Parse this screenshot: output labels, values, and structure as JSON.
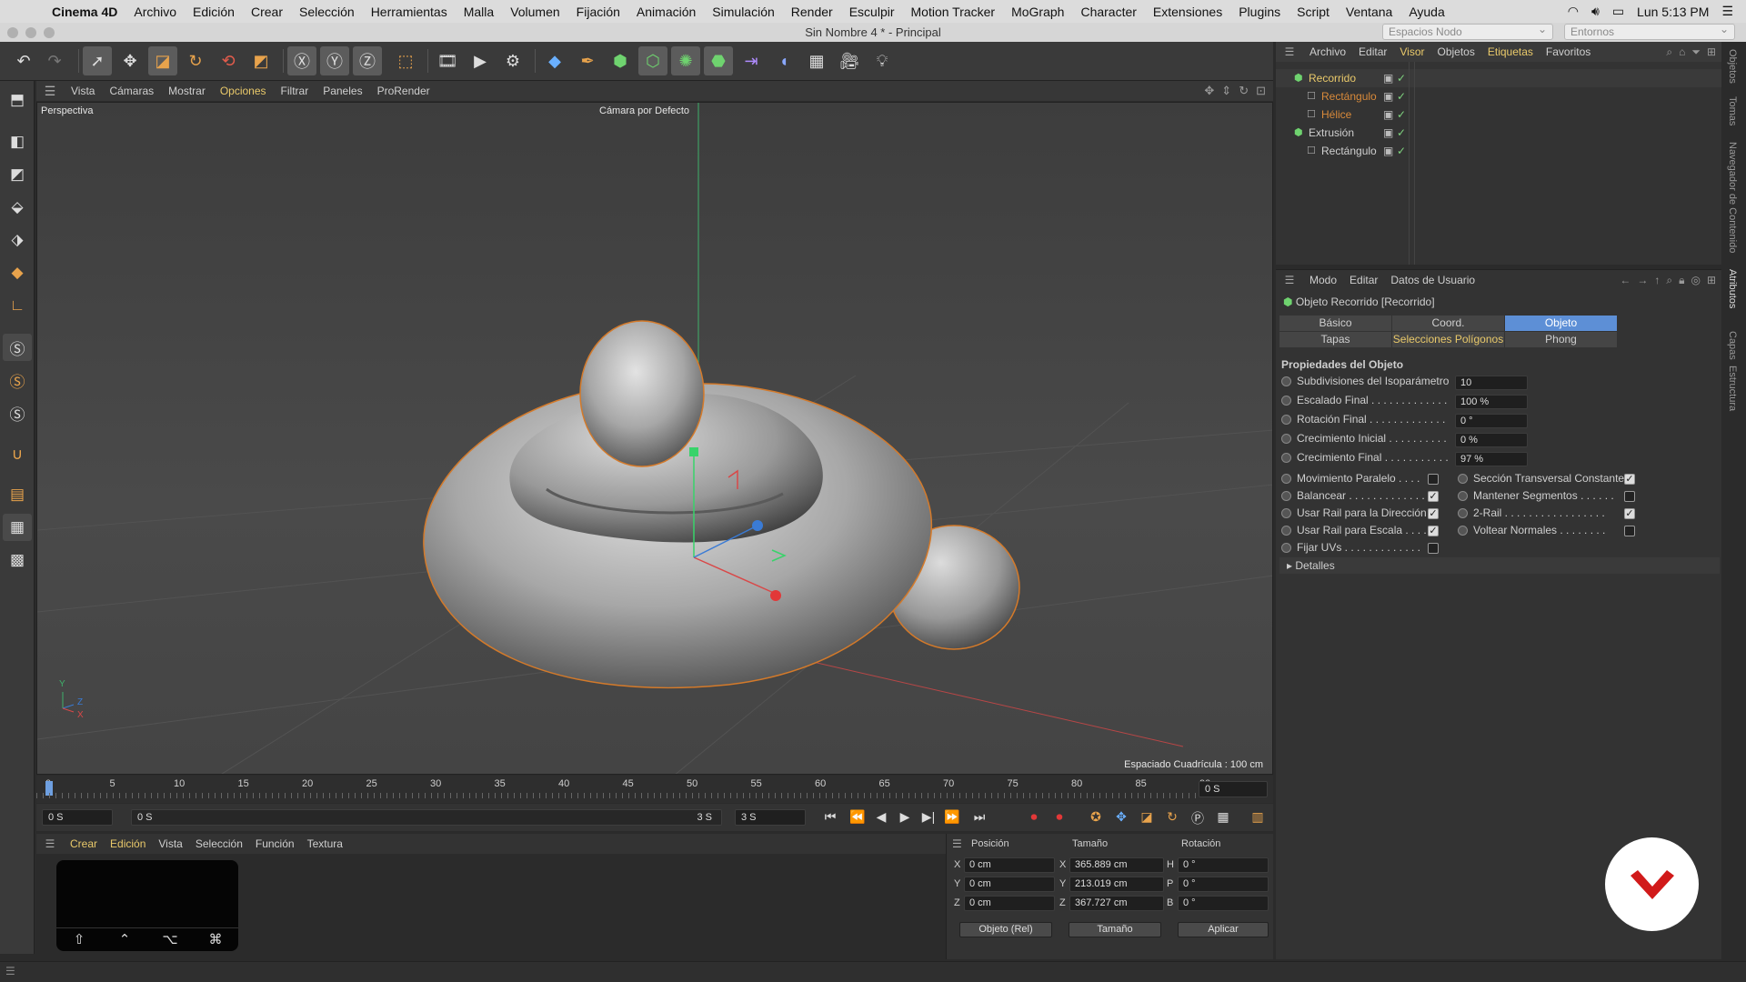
{
  "macmenu": {
    "app": "Cinema 4D",
    "items": [
      "Archivo",
      "Edición",
      "Crear",
      "Selección",
      "Herramientas",
      "Malla",
      "Volumen",
      "Fijación",
      "Animación",
      "Simulación",
      "Render",
      "Esculpir",
      "Motion Tracker",
      "MoGraph",
      "Character",
      "Extensiones",
      "Plugins",
      "Script",
      "Ventana",
      "Ayuda"
    ],
    "clock": "Lun 5:13 PM"
  },
  "window": {
    "title": "Sin Nombre 4 * - Principal",
    "node_spaces": "Espacios Nodo",
    "environments": "Entornos"
  },
  "viewport": {
    "menu": [
      "Vista",
      "Cámaras",
      "Mostrar",
      "Opciones",
      "Filtrar",
      "Paneles",
      "ProRender"
    ],
    "highlighted_menu": "Opciones",
    "view_name": "Perspectiva",
    "camera": "Cámara por Defecto",
    "grid_spacing": "Espaciado Cuadrícula : 100 cm",
    "axis_labels": {
      "y": "Y",
      "z": "Z",
      "x": "X"
    }
  },
  "timeline": {
    "ticks": [
      "0",
      "5",
      "10",
      "15",
      "20",
      "25",
      "30",
      "35",
      "40",
      "45",
      "50",
      "55",
      "60",
      "65",
      "70",
      "75",
      "80",
      "85",
      "90"
    ],
    "current_frame": "0 S",
    "start": "0 S",
    "range_start": "0 S",
    "range_end": "3 S",
    "end": "3 S"
  },
  "material_manager": {
    "menu": [
      "Crear",
      "Edición",
      "Vista",
      "Selección",
      "Función",
      "Textura"
    ],
    "highlighted": [
      "Crear",
      "Edición"
    ],
    "keys": [
      "⇧",
      "⌃",
      "⌥",
      "⌘"
    ]
  },
  "coordinates": {
    "headers": [
      "Posición",
      "Tamaño",
      "Rotación"
    ],
    "rows": [
      {
        "axis": "X",
        "pos": "0 cm",
        "size_axis": "X",
        "size": "365.889 cm",
        "rot_axis": "H",
        "rot": "0 °"
      },
      {
        "axis": "Y",
        "pos": "0 cm",
        "size_axis": "Y",
        "size": "213.019 cm",
        "rot_axis": "P",
        "rot": "0 °"
      },
      {
        "axis": "Z",
        "pos": "0 cm",
        "size_axis": "Z",
        "size": "367.727 cm",
        "rot_axis": "B",
        "rot": "0 °"
      }
    ],
    "mode": "Objeto (Rel)",
    "size_mode": "Tamaño",
    "apply": "Aplicar"
  },
  "object_manager": {
    "menu": [
      "Archivo",
      "Editar",
      "Visor",
      "Objetos",
      "Etiquetas",
      "Favoritos"
    ],
    "highlighted": [
      "Visor",
      "Etiquetas"
    ],
    "objects": [
      {
        "name": "Recorrido",
        "color": "#e9c96a",
        "indent": 0
      },
      {
        "name": "Rectángulo",
        "color": "#d98a3a",
        "indent": 1
      },
      {
        "name": "Hélice",
        "color": "#d98a3a",
        "indent": 1
      },
      {
        "name": "Extrusión",
        "color": "#cfcfcf",
        "indent": 0
      },
      {
        "name": "Rectángulo",
        "color": "#cfcfcf",
        "indent": 1
      }
    ]
  },
  "attributes": {
    "menu": [
      "Modo",
      "Editar",
      "Datos de Usuario"
    ],
    "object_title": "Objeto Recorrido [Recorrido]",
    "tabs_row1": [
      "Básico",
      "Coord.",
      "Objeto"
    ],
    "tabs_row2": [
      "Tapas",
      "Selecciones Polígonos",
      "Phong"
    ],
    "active_tab": "Objeto",
    "section": "Propiedades del Objeto",
    "numeric_props": [
      {
        "label": "Subdivisiones del Isoparámetro",
        "value": "10"
      },
      {
        "label": "Escalado Final . . . . . . . . . . . . .",
        "value": "100 %"
      },
      {
        "label": "Rotación Final . . . . . . . . . . . . .",
        "value": "0 °"
      },
      {
        "label": "Crecimiento Inicial . . . . . . . . . .",
        "value": "0 %"
      },
      {
        "label": "Crecimiento Final . . . . . . . . . . .",
        "value": "97 %"
      }
    ],
    "left_checks": [
      {
        "label": "Movimiento Paralelo . . . .",
        "checked": false
      },
      {
        "label": "Balancear . . . . . . . . . . . . .",
        "checked": true
      },
      {
        "label": "Usar Rail para la Dirección",
        "checked": true
      },
      {
        "label": "Usar Rail para Escala . . . .",
        "checked": true
      },
      {
        "label": "Fijar UVs . . . . . . . . . . . . .",
        "checked": false
      }
    ],
    "right_checks": [
      {
        "label": "Sección Transversal Constante",
        "checked": true
      },
      {
        "label": "Mantener Segmentos . . . . . .",
        "checked": false
      },
      {
        "label": "2-Rail . . . . . . . . . . . . . . . . .",
        "checked": true
      },
      {
        "label": "Voltear Normales . . . . . . . .",
        "checked": false
      }
    ],
    "details": "Detalles"
  },
  "side_tabs": [
    "Objetos",
    "Tomas",
    "Navegador de Contenido",
    "Atributos",
    "Capas",
    "Estructura"
  ]
}
